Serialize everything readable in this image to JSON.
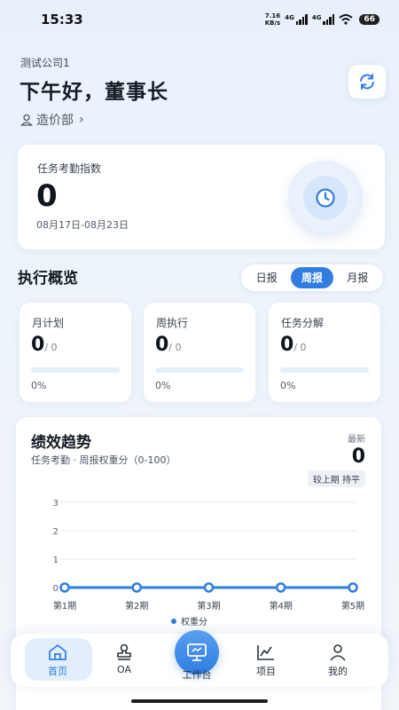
{
  "status": {
    "time": "15:33",
    "net_speed_value": "7.16",
    "net_speed_unit": "KB/s",
    "signal1_label": "4G",
    "signal2_label": "4G",
    "battery": "66"
  },
  "header": {
    "company": "测试公司1",
    "greeting": "下午好，董事长",
    "department": "造价部",
    "department_chevron": "›"
  },
  "index_card": {
    "title": "任务考勤指数",
    "value": "0",
    "date_range": "08月17日-08月23日"
  },
  "overview": {
    "title": "执行概览",
    "tabs": [
      {
        "label": "日报",
        "active": false
      },
      {
        "label": "周报",
        "active": true
      },
      {
        "label": "月报",
        "active": false
      }
    ],
    "stats": [
      {
        "label": "月计划",
        "value": "0",
        "total": "/ 0",
        "percent_text": "0%",
        "progress": 0
      },
      {
        "label": "周执行",
        "value": "0",
        "total": "/ 0",
        "percent_text": "0%",
        "progress": 0
      },
      {
        "label": "任务分解",
        "value": "0",
        "total": "/ 0",
        "percent_text": "0%",
        "progress": 0
      }
    ]
  },
  "trend": {
    "title": "绩效趋势",
    "subtitle": "任务考勤 · 周报权重分（0-100）",
    "latest_label": "最新",
    "latest_value": "0",
    "compare": "较上期 持平"
  },
  "chart_data": {
    "type": "line",
    "categories": [
      "第1期",
      "第2期",
      "第3期",
      "第4期",
      "第5期"
    ],
    "series": [
      {
        "name": "权重分",
        "values": [
          0,
          0,
          0,
          0,
          0
        ]
      }
    ],
    "ylim": [
      0,
      3
    ],
    "yticks": [
      "0",
      "1",
      "2",
      "3"
    ],
    "grid": true,
    "legend": "bottom",
    "color": "#2f7de1"
  },
  "tabbar": {
    "items": [
      {
        "label": "首页",
        "icon": "home-icon"
      },
      {
        "label": "OA",
        "icon": "stamp-icon"
      },
      {
        "label": "工作台",
        "icon": "monitor-icon"
      },
      {
        "label": "项目",
        "icon": "chart-icon"
      },
      {
        "label": "我的",
        "icon": "person-icon"
      }
    ]
  },
  "colors": {
    "accent": "#2f7de1",
    "track": "#e3effa"
  }
}
